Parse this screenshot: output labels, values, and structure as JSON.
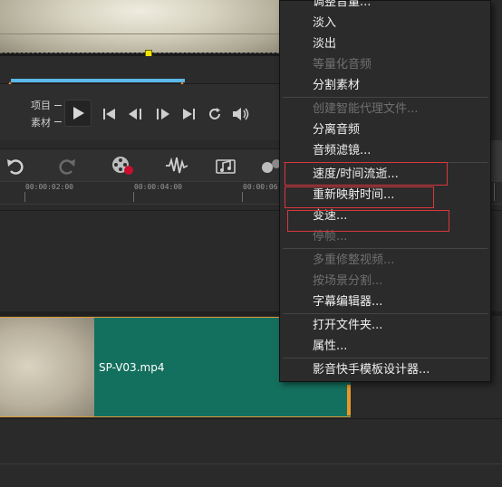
{
  "transport": {
    "mode_project": "项目",
    "mode_clip": "素材"
  },
  "ruler": {
    "labels": [
      "00:00:02:00",
      "00:00:04:00",
      "00:00:06"
    ]
  },
  "clip": {
    "name": "SP-V03.mp4"
  },
  "context_menu": {
    "items": [
      {
        "label": "调整音量...",
        "enabled": true
      },
      {
        "label": "淡入",
        "enabled": true
      },
      {
        "label": "淡出",
        "enabled": true
      },
      {
        "label": "等量化音频",
        "enabled": false
      },
      {
        "label": "分割素材",
        "enabled": true
      },
      {
        "label": "创建智能代理文件...",
        "enabled": false
      },
      {
        "label": "分离音频",
        "enabled": true
      },
      {
        "label": "音频滤镜...",
        "enabled": true
      },
      {
        "label": "速度/时间流逝...",
        "enabled": true,
        "highlighted": true
      },
      {
        "label": "重新映射时间...",
        "enabled": true,
        "highlighted": true
      },
      {
        "label": "变速...",
        "enabled": true,
        "highlighted": true
      },
      {
        "label": "停帧...",
        "enabled": false
      },
      {
        "label": "多重修整视频...",
        "enabled": false
      },
      {
        "label": "按场景分割...",
        "enabled": false
      },
      {
        "label": "字幕编辑器...",
        "enabled": true
      },
      {
        "label": "打开文件夹...",
        "enabled": true
      },
      {
        "label": "属性...",
        "enabled": true
      },
      {
        "label": "影音快手模板设计器...",
        "enabled": true
      }
    ],
    "highlight_color": "#d9363e"
  },
  "colors": {
    "clip_fill": "#14705e",
    "trim_track": "#5bb8e8",
    "trim_handle": "#e8882a"
  }
}
